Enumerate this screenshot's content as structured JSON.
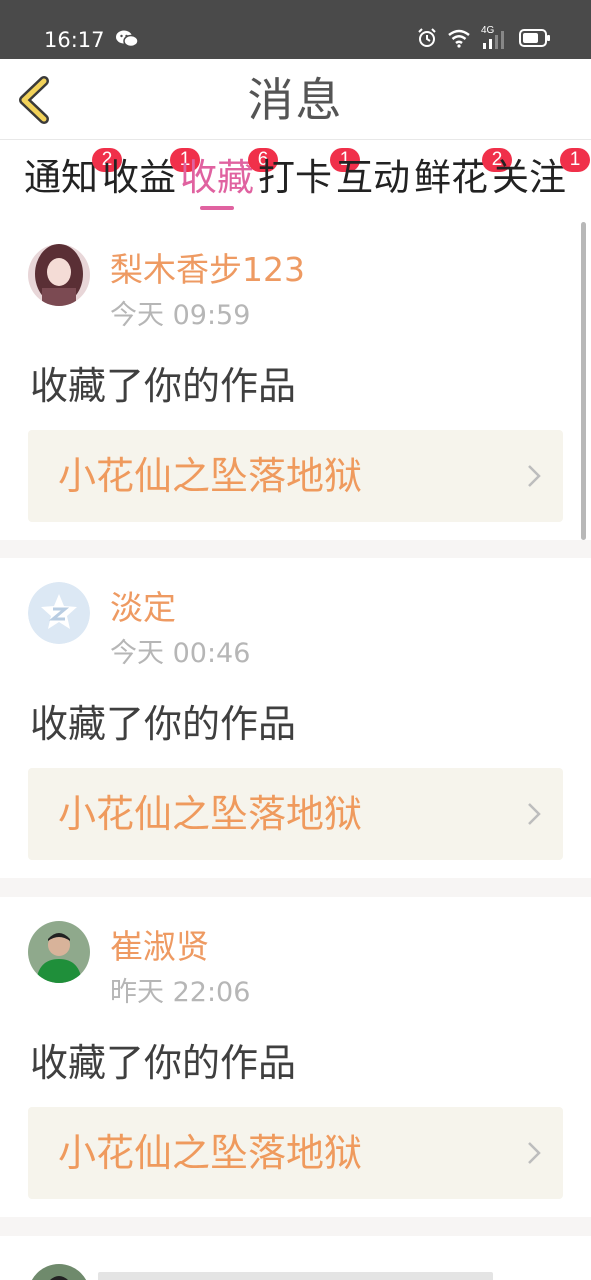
{
  "status_bar": {
    "time": "16:17",
    "network": "4G"
  },
  "header": {
    "title": "消息"
  },
  "tabs": [
    {
      "label": "通知",
      "badge": "2"
    },
    {
      "label": "收益",
      "badge": "1"
    },
    {
      "label": "收藏",
      "badge": "6",
      "active": true
    },
    {
      "label": "打卡",
      "badge": "1"
    },
    {
      "label": "互动",
      "badge": ""
    },
    {
      "label": "鲜花",
      "badge": "2"
    },
    {
      "label": "关注",
      "badge": "1"
    }
  ],
  "messages": [
    {
      "username": "梨木香步123",
      "time": "今天 09:59",
      "action": "收藏了你的作品",
      "work": "小花仙之坠落地狱"
    },
    {
      "username": "淡定",
      "time": "今天 00:46",
      "action": "收藏了你的作品",
      "work": "小花仙之坠落地狱"
    },
    {
      "username": "崔淑贤",
      "time": "昨天 22:06",
      "action": "收藏了你的作品",
      "work": "小花仙之坠落地狱"
    }
  ],
  "colors": {
    "accent": "#e062a0",
    "username": "#ee9a62",
    "work_title": "#ef9a5d",
    "badge": "#f0304a"
  }
}
